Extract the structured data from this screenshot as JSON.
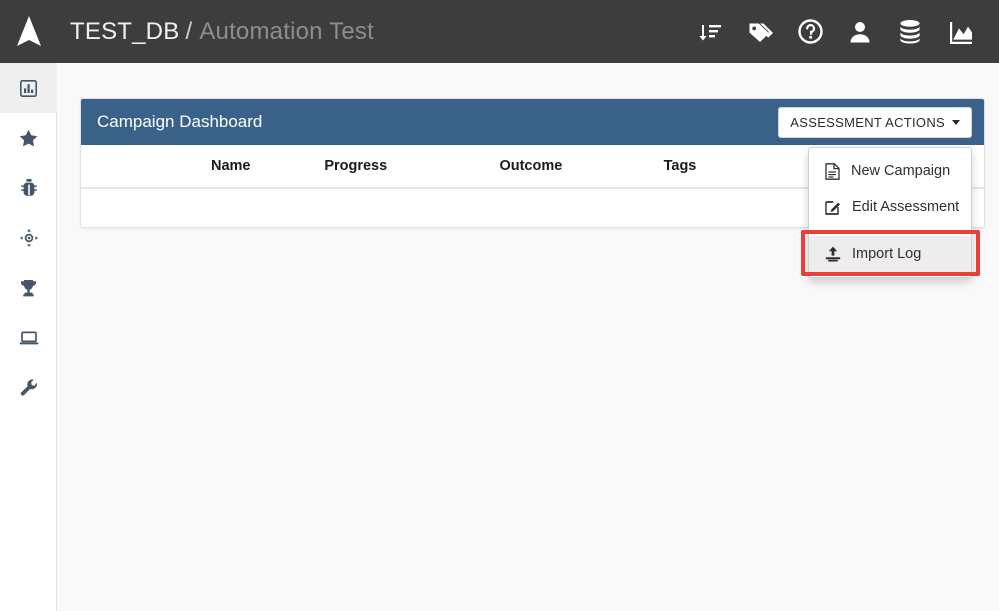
{
  "navbar": {
    "logo_icon": "navigation-arrow-logo",
    "breadcrumb": {
      "database": "TEST_DB",
      "separator": "/",
      "page": "Automation Test"
    },
    "icons": [
      {
        "name": "sort-amount-down-icon",
        "label": "Sort"
      },
      {
        "name": "tags-icon",
        "label": "Tags"
      },
      {
        "name": "help-circle-icon",
        "label": "Help"
      },
      {
        "name": "user-icon",
        "label": "User"
      },
      {
        "name": "database-icon",
        "label": "Database"
      },
      {
        "name": "chart-area-icon",
        "label": "Analytics"
      }
    ]
  },
  "sidebar": {
    "items": [
      {
        "name": "sidebar-item-dashboard",
        "icon": "chart-bar-icon",
        "active": true
      },
      {
        "name": "sidebar-item-favorites",
        "icon": "star-icon",
        "active": false
      },
      {
        "name": "sidebar-item-payloads",
        "icon": "bug-icon",
        "active": false
      },
      {
        "name": "sidebar-item-targets",
        "icon": "crosshairs-icon",
        "active": false
      },
      {
        "name": "sidebar-item-achievements",
        "icon": "trophy-icon",
        "active": false
      },
      {
        "name": "sidebar-item-hosts",
        "icon": "laptop-icon",
        "active": false
      },
      {
        "name": "sidebar-item-tools",
        "icon": "wrench-icon",
        "active": false
      }
    ]
  },
  "panel": {
    "title": "Campaign Dashboard",
    "actions_button": {
      "label": "ASSESSMENT ACTIONS",
      "caret_icon": "chevron-down-icon",
      "expanded": true
    },
    "menu": {
      "items": [
        {
          "label": "New Campaign",
          "icon": "file-document-icon",
          "name": "menu-item-new-campaign",
          "highlighted": false
        },
        {
          "label": "Edit Assessment",
          "icon": "edit-pencil-square-icon",
          "name": "menu-item-edit-assessment",
          "highlighted": false
        },
        {
          "label": "Import Log",
          "icon": "upload-icon",
          "name": "menu-item-import-log",
          "highlighted": true
        }
      ]
    },
    "table": {
      "columns": [
        "Name",
        "Progress",
        "Outcome",
        "Tags"
      ],
      "rows": []
    }
  },
  "colors": {
    "navbar_bg": "#3d3d3d",
    "panel_header_bg": "#3a6188",
    "page_bg": "#f9f9f9",
    "sidebar_bg": "#ffffff",
    "highlight_ring": "#ec3c3c",
    "menu_hover_bg": "#ededed"
  }
}
